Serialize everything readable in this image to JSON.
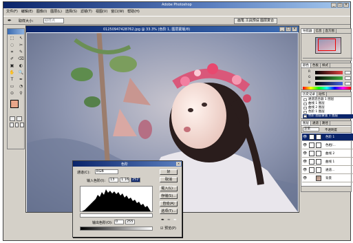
{
  "app": {
    "title": "Adobe Photoshop",
    "window_buttons": [
      "_",
      "□",
      "×"
    ],
    "menu": [
      "文件(F)",
      "编辑(E)",
      "图像(I)",
      "图层(L)",
      "选择(S)",
      "滤镜(T)",
      "视图(V)",
      "窗口(W)",
      "帮助(H)"
    ]
  },
  "options": {
    "tool_icon": "eyedropper-icon",
    "sample_label": "取样大小:",
    "sample_value": "取样点",
    "wells_tab": "画笔 工具预设 图层复合"
  },
  "toolbox": {
    "tools": [
      "⬚",
      "↖",
      "◌",
      "✂",
      "⌗",
      "✎",
      "✐",
      "⌫",
      "▣",
      "◐",
      "✋",
      "🔍",
      "T",
      "✒",
      "▭",
      "◔",
      "⊙",
      "⚲"
    ],
    "foreground_color": "#e8a68a",
    "background_color": "#ffffff"
  },
  "document": {
    "title": "01250947428762.jpg @ 33.3% (色阶 1, 图层蒙版/8)",
    "buttons": [
      "_",
      "□",
      "×"
    ]
  },
  "levels": {
    "title": "色阶",
    "channel_label": "通道(C):",
    "channel_value": "RGB",
    "input_label": "输入色阶(I):",
    "input_values": [
      "13",
      "1.16",
      "252"
    ],
    "output_label": "输出色阶(O):",
    "output_values": [
      "0",
      "255"
    ],
    "buttons": [
      "好",
      "取消",
      "载入(L)...",
      "存储(S)...",
      "自动(A)",
      "选项(T)..."
    ],
    "preview_label": "预览(P)",
    "preview_checked": true
  },
  "navigator": {
    "tabs": [
      "导航器",
      "信息",
      "直方图"
    ]
  },
  "color_panel": {
    "tabs": [
      "颜色",
      "色板",
      "样式"
    ],
    "channels": [
      {
        "label": "R",
        "value": "",
        "color": "#e04040"
      },
      {
        "label": "G",
        "value": "",
        "color": "#40b040"
      },
      {
        "label": "B",
        "value": "",
        "color": "#4060e0"
      }
    ]
  },
  "history": {
    "tabs": [
      "历史记录",
      "动作"
    ],
    "items": [
      "通道混合器 1 图层",
      "曲线 1 图层",
      "曲线 2 图层",
      "色阶 1 图层",
      "色阶 图层蒙版 1 图层"
    ],
    "selected_index": 4
  },
  "layers": {
    "tabs": [
      "图层",
      "通道",
      "路径"
    ],
    "blend_mode": "正常",
    "opacity_label": "不透明度",
    "items": [
      "色阶 1",
      "色相/...",
      "曲线 2",
      "曲线 1",
      "通道...",
      "背景"
    ],
    "selected_index": 0
  }
}
